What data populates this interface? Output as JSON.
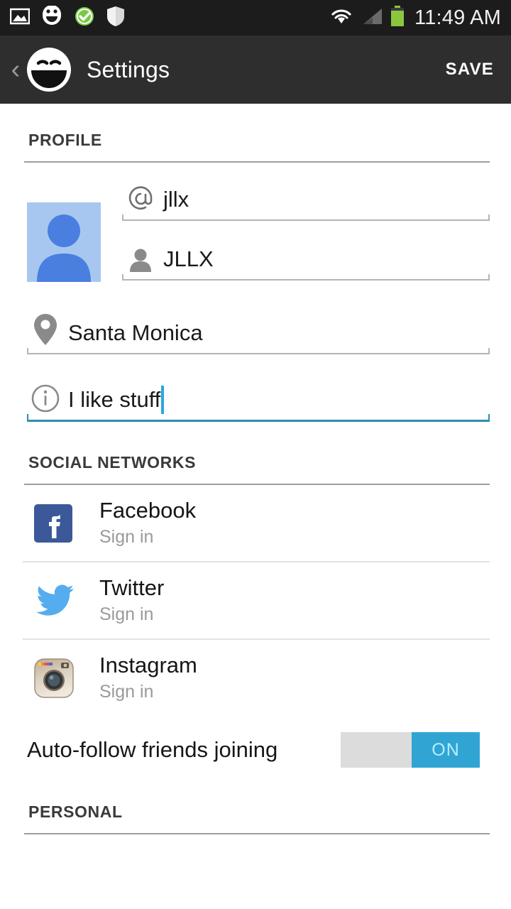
{
  "status_bar": {
    "time": "11:49 AM",
    "left_icons": [
      "image-icon",
      "smiley-icon",
      "check-circle-icon",
      "shield-icon"
    ],
    "right_icons": [
      "wifi-icon",
      "signal-icon",
      "battery-icon"
    ],
    "background": "#1c1c1c",
    "battery_color": "#8cc63f"
  },
  "action_bar": {
    "back_label": "‹",
    "logo": "smiley-logo",
    "title": "Settings",
    "save_label": "SAVE",
    "background": "#2e2e2e"
  },
  "sections": {
    "profile": {
      "header": "PROFILE",
      "avatar": "default-avatar",
      "avatar_bg": "#a8c7f0",
      "avatar_fg": "#4a7fe0",
      "fields": [
        {
          "icon": "at-icon",
          "value": "jllx",
          "focused": false
        },
        {
          "icon": "person-icon",
          "value": "JLLX",
          "focused": false
        },
        {
          "icon": "location-pin-icon",
          "value": "Santa Monica",
          "focused": false
        },
        {
          "icon": "info-icon",
          "value": "I like stuff",
          "focused": true
        }
      ]
    },
    "social": {
      "header": "SOCIAL NETWORKS",
      "items": [
        {
          "icon": "facebook-icon",
          "name": "Facebook",
          "status": "Sign in",
          "color": "#3b5998"
        },
        {
          "icon": "twitter-icon",
          "name": "Twitter",
          "status": "Sign in",
          "color": "#55acee"
        },
        {
          "icon": "instagram-icon",
          "name": "Instagram",
          "status": "Sign in",
          "color": "#c8b9a6"
        }
      ],
      "toggle": {
        "label": "Auto-follow friends joining",
        "state": "ON",
        "on_color": "#30a5d4",
        "track_color": "#dcdcdc"
      }
    },
    "personal": {
      "header": "PERSONAL"
    }
  },
  "accent_color": "#2e8fb0"
}
